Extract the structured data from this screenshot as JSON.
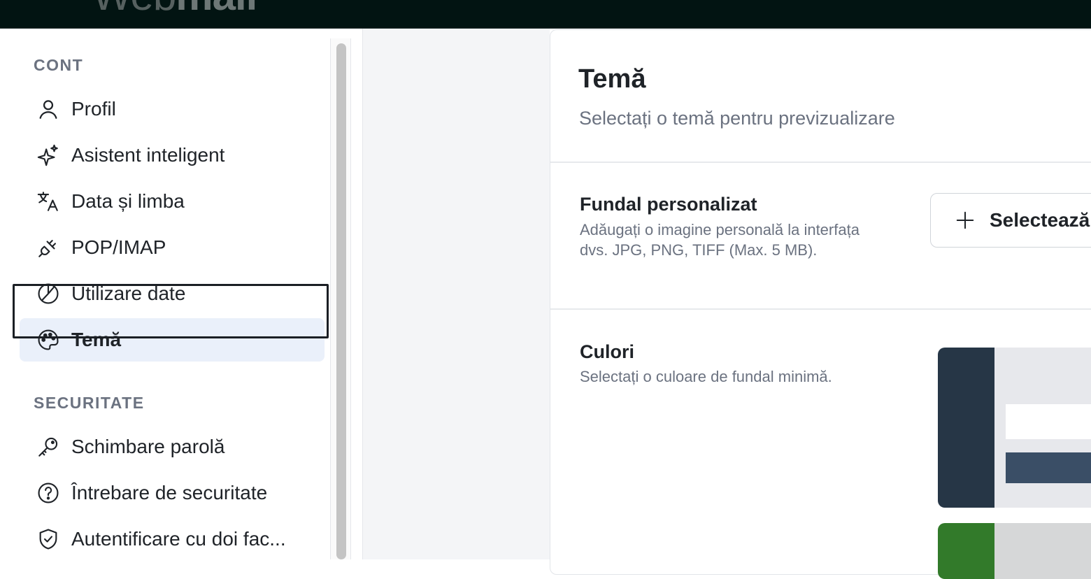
{
  "header": {
    "logo_light": "Web",
    "logo_bold": "mail"
  },
  "sidebar": {
    "sections": [
      {
        "title": "CONT",
        "items": [
          {
            "label": "Profil",
            "icon": "user-icon"
          },
          {
            "label": "Asistent inteligent",
            "icon": "sparkles-icon"
          },
          {
            "label": "Data și limba",
            "icon": "translate-icon"
          },
          {
            "label": "POP/IMAP",
            "icon": "plug-icon"
          },
          {
            "label": "Utilizare date",
            "icon": "pie-chart-icon"
          },
          {
            "label": "Temă",
            "icon": "palette-icon",
            "active": true
          }
        ]
      },
      {
        "title": "SECURITATE",
        "items": [
          {
            "label": "Schimbare parolă",
            "icon": "key-icon"
          },
          {
            "label": "Întrebare de securitate",
            "icon": "question-circle-icon"
          },
          {
            "label": "Autentificare cu doi fac...",
            "icon": "shield-check-icon"
          }
        ]
      }
    ]
  },
  "main": {
    "title": "Temă",
    "subtitle": "Selectați o temă pentru previzualizare",
    "custom_background": {
      "title": "Fundal personalizat",
      "description": "Adăugați o imagine personală la interfața dvs. JPG, PNG, TIFF (Max. 5 MB).",
      "button_label": "Selectează"
    },
    "colors": {
      "title": "Culori",
      "description": "Selectați o culoare de fundal minimă.",
      "themes": [
        {
          "sidebar_color": "#263646",
          "main_color": "#e7e8ec",
          "accent_color": "#3a4e66"
        },
        {
          "sidebar_color": "#327a2a",
          "main_color": "#d6d7d8",
          "accent_color": "#3f7a36"
        }
      ]
    }
  },
  "colors": {
    "accent_active_bg": "#eaf0fa",
    "topbar_bg": "#021412",
    "muted_text": "#6b7280"
  }
}
